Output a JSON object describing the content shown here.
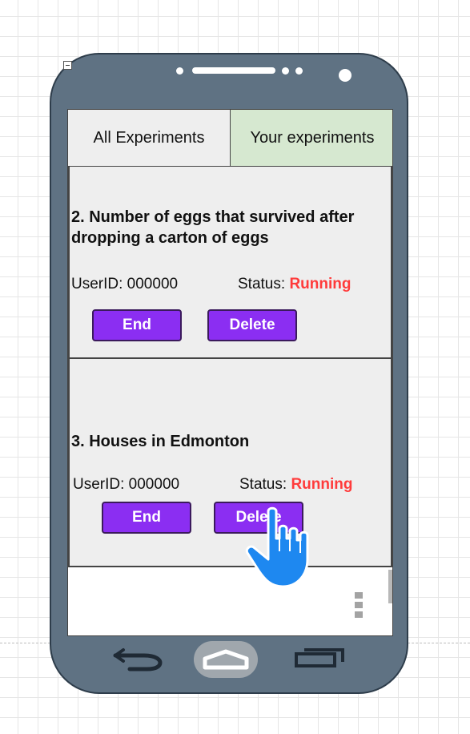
{
  "tabs": [
    {
      "label": "All Experiments",
      "selected": false
    },
    {
      "label": "Your experiments",
      "selected": true
    }
  ],
  "experiments": [
    {
      "title": "2. Number of eggs that survived after dropping a carton of eggs",
      "user_id": "UserID: 000000",
      "status_label": "Status:",
      "status_value": "Running",
      "end_label": "End",
      "delete_label": "Delete"
    },
    {
      "title": "3. Houses in Edmonton",
      "user_id": "UserID: 000000",
      "status_label": "Status:",
      "status_value": "Running",
      "end_label": "End",
      "delete_label": "Delete"
    }
  ],
  "colors": {
    "phone_body": "#5f7283",
    "button_purple": "#8b2ef2",
    "status_red": "#ff3b3b",
    "selected_tab": "#d6e8d0",
    "cursor_blue": "#1e88f0"
  },
  "icons": {
    "cursor": "hand-pointer-icon",
    "back": "back-arrow-icon",
    "home": "home-icon",
    "recent": "recent-apps-icon",
    "overflow": "overflow-menu-icon"
  }
}
